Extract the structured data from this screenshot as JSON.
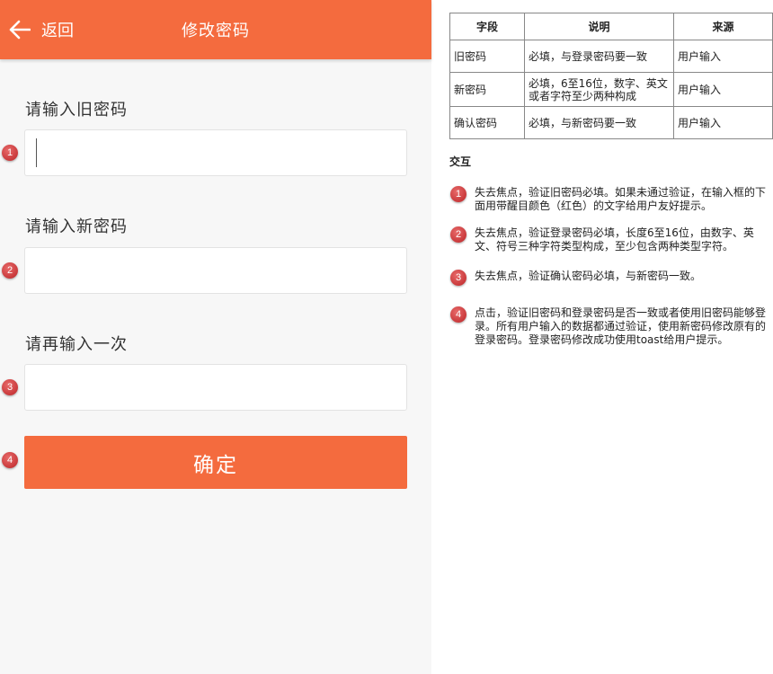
{
  "header": {
    "back_label": "返回",
    "title": "修改密码"
  },
  "form": {
    "old_password": {
      "label": "请输入旧密码",
      "value": "",
      "placeholder": ""
    },
    "new_password": {
      "label": "请输入新密码",
      "value": "",
      "placeholder": ""
    },
    "confirm_password": {
      "label": "请再输入一次",
      "value": "",
      "placeholder": ""
    },
    "submit_label": "确定"
  },
  "badges": [
    "1",
    "2",
    "3",
    "4"
  ],
  "spec": {
    "headers": [
      "字段",
      "说明",
      "来源"
    ],
    "rows": [
      {
        "field": "旧密码",
        "desc": "必填，与登录密码要一致",
        "source": "用户输入"
      },
      {
        "field": "新密码",
        "desc": "必填，6至16位，数字、英文或者字符至少两种构成",
        "source": "用户输入"
      },
      {
        "field": "确认密码",
        "desc": "必填，与新密码要一致",
        "source": "用户输入"
      }
    ]
  },
  "interaction": {
    "title": "交互",
    "notes": [
      "失去焦点，验证旧密码必填。如果未通过验证，在输入框的下面用带醒目颜色（红色）的文字给用户友好提示。",
      "失去焦点，验证登录密码必填，长度6至16位，由数字、英文、符号三种字符类型构成，至少包含两种类型字符。",
      "失去焦点，验证确认密码必填，与新密码一致。",
      "点击，验证旧密码和登录密码是否一致或者使用旧密码能够登录。所有用户输入的数据都通过验证，使用新密码修改原有的登录密码。登录密码修改成功使用toast给用户提示。"
    ]
  },
  "colors": {
    "brand": "#f46b3e",
    "badge": "#c9393b",
    "background": "#f7f7f7"
  },
  "icons": {
    "back": "arrow-left-icon"
  }
}
